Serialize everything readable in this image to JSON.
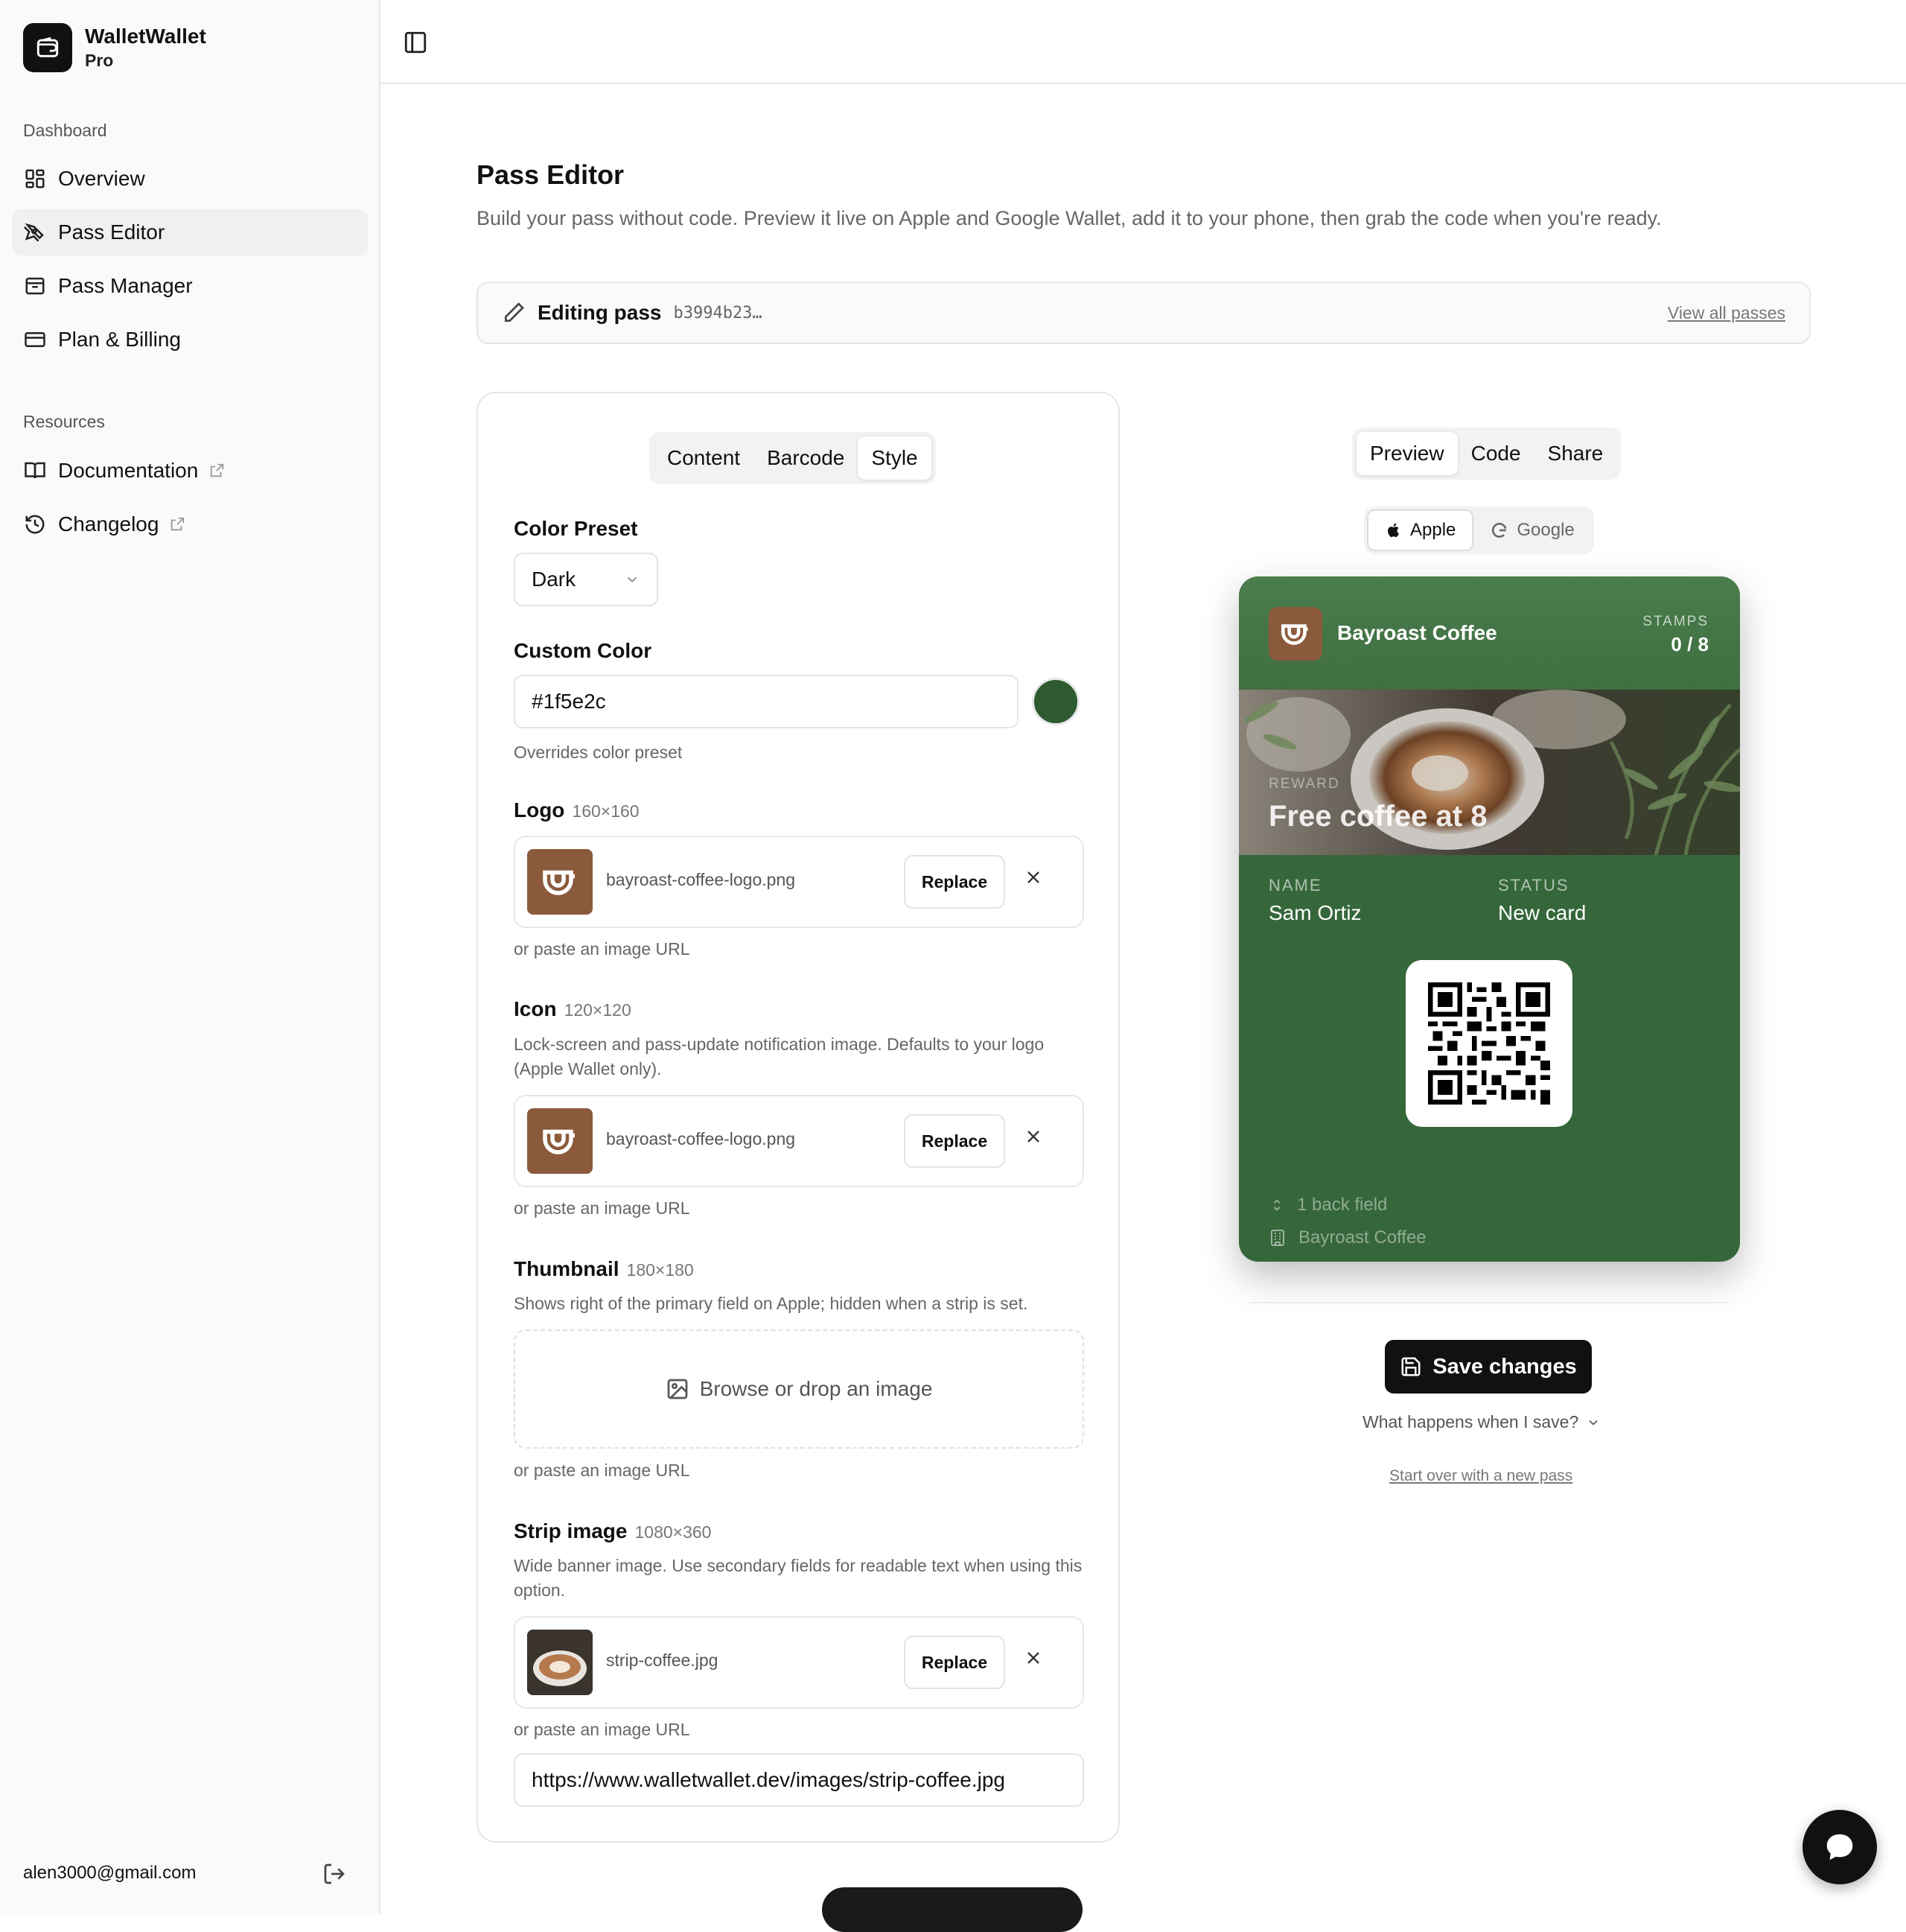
{
  "sidebar": {
    "brand_name": "WalletWallet",
    "brand_plan": "Pro",
    "section_dashboard": "Dashboard",
    "items": [
      {
        "label": "Overview",
        "icon": "grid-icon"
      },
      {
        "label": "Pass Editor",
        "icon": "pen-tool-icon"
      },
      {
        "label": "Pass Manager",
        "icon": "archive-icon"
      },
      {
        "label": "Plan & Billing",
        "icon": "credit-card-icon"
      }
    ],
    "section_resources": "Resources",
    "resources": [
      {
        "label": "Documentation",
        "icon": "book-icon"
      },
      {
        "label": "Changelog",
        "icon": "history-icon"
      }
    ],
    "user_email": "alen3000@gmail.com"
  },
  "page": {
    "title": "Pass Editor",
    "description": "Build your pass without code. Preview it live on Apple and Google Wallet, add it to your phone, then grab the code when you're ready."
  },
  "editing": {
    "label": "Editing pass",
    "pass_id": "b3994b23…",
    "view_all": "View all passes"
  },
  "editor": {
    "tabs": [
      "Content",
      "Barcode",
      "Style"
    ],
    "active_tab": "Style",
    "color_preset_label": "Color Preset",
    "color_preset_value": "Dark",
    "custom_color_label": "Custom Color",
    "custom_color_value": "#1f5e2c",
    "custom_color_hint": "Overrides color preset",
    "paste_url_hint": "or paste an image URL",
    "replace_label": "Replace",
    "logo": {
      "label": "Logo",
      "dims": "160×160",
      "file": "bayroast-coffee-logo.png"
    },
    "icon": {
      "label": "Icon",
      "dims": "120×120",
      "hint": "Lock-screen and pass-update notification image. Defaults to your logo (Apple Wallet only).",
      "file": "bayroast-coffee-logo.png"
    },
    "thumbnail": {
      "label": "Thumbnail",
      "dims": "180×180",
      "hint": "Shows right of the primary field on Apple; hidden when a strip is set.",
      "dropzone": "Browse or drop an image"
    },
    "strip": {
      "label": "Strip image",
      "dims": "1080×360",
      "hint": "Wide banner image. Use secondary fields for readable text when using this option.",
      "file": "strip-coffee.jpg",
      "url": "https://www.walletwallet.dev/images/strip-coffee.jpg"
    }
  },
  "preview": {
    "tabs": [
      "Preview",
      "Code",
      "Share"
    ],
    "active_tab": "Preview",
    "platforms": [
      "Apple",
      "Google"
    ],
    "active_platform": "Apple",
    "pass": {
      "org": "Bayroast Coffee",
      "stamps_label": "STAMPS",
      "stamps_value": "0 / 8",
      "primary_label": "REWARD",
      "primary_value": "Free coffee at 8",
      "name_label": "NAME",
      "name_value": "Sam Ortiz",
      "status_label": "STATUS",
      "status_value": "New card",
      "back_fields": "1 back field",
      "footer_org": "Bayroast Coffee",
      "bg_color": "#35673a"
    },
    "save_label": "Save changes",
    "what_happens": "What happens when I save?",
    "start_over": "Start over with a new pass"
  },
  "colors": {
    "accent": "#111111",
    "pass_green": "#35673a",
    "swatch": "#2d5a30",
    "logo_brown": "#8b5a3c"
  }
}
